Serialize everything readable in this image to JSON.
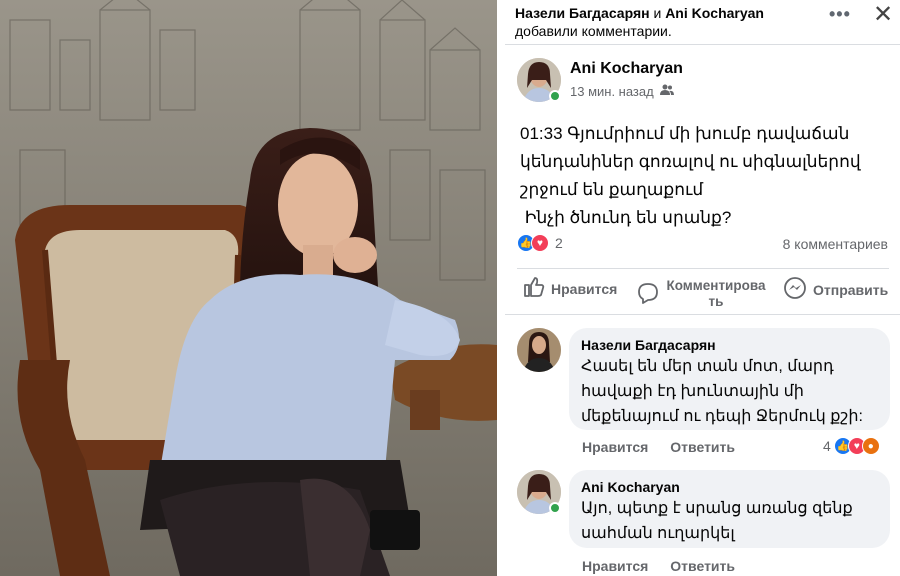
{
  "notification": {
    "name1": "Назели Багдасарян",
    "conj": " и ",
    "name2": "Ani Kocharyan",
    "text": "добавили комментарии."
  },
  "header_icons": {
    "more": "more-dots-icon",
    "close": "close-icon"
  },
  "post": {
    "author": "Ani Kocharyan",
    "time": "13 мин. назад",
    "audience_icon": "friends-icon",
    "lines": [
      "01:33 Գյումրիում մի խումբ դավաճան",
      "կենդանիներ գոռալով ու սիգնալներով",
      "շրջում են քաղաքում",
      " Ինչի ծնունդ են սրանք?"
    ],
    "reaction_count": "2",
    "comments_count": "8 комментариев"
  },
  "actions": {
    "like": "Нравится",
    "comment_line1": "Комментирова",
    "comment_line2": "ть",
    "send": "Отправить"
  },
  "comments": [
    {
      "name": "Назели Багдасарян",
      "lines": [
        "Հասել են մեր տան մոտ, մարդ",
        "հավաքի էդ խունտային մի",
        "մեքենայում ու դեպի Ջերմուկ քշի:"
      ],
      "like": "Нравится",
      "reply": "Ответить",
      "react_count": "4"
    },
    {
      "name": "Ani Kocharyan",
      "lines": [
        "Այո, պետք է սրանց առանց զենք",
        "սահման ուղարկել"
      ],
      "like": "Нравится",
      "reply": "Ответить"
    }
  ],
  "colors": {
    "link": "#1877f2",
    "muted": "#65676b",
    "bubble": "#f0f2f5",
    "online": "#31a24c"
  }
}
